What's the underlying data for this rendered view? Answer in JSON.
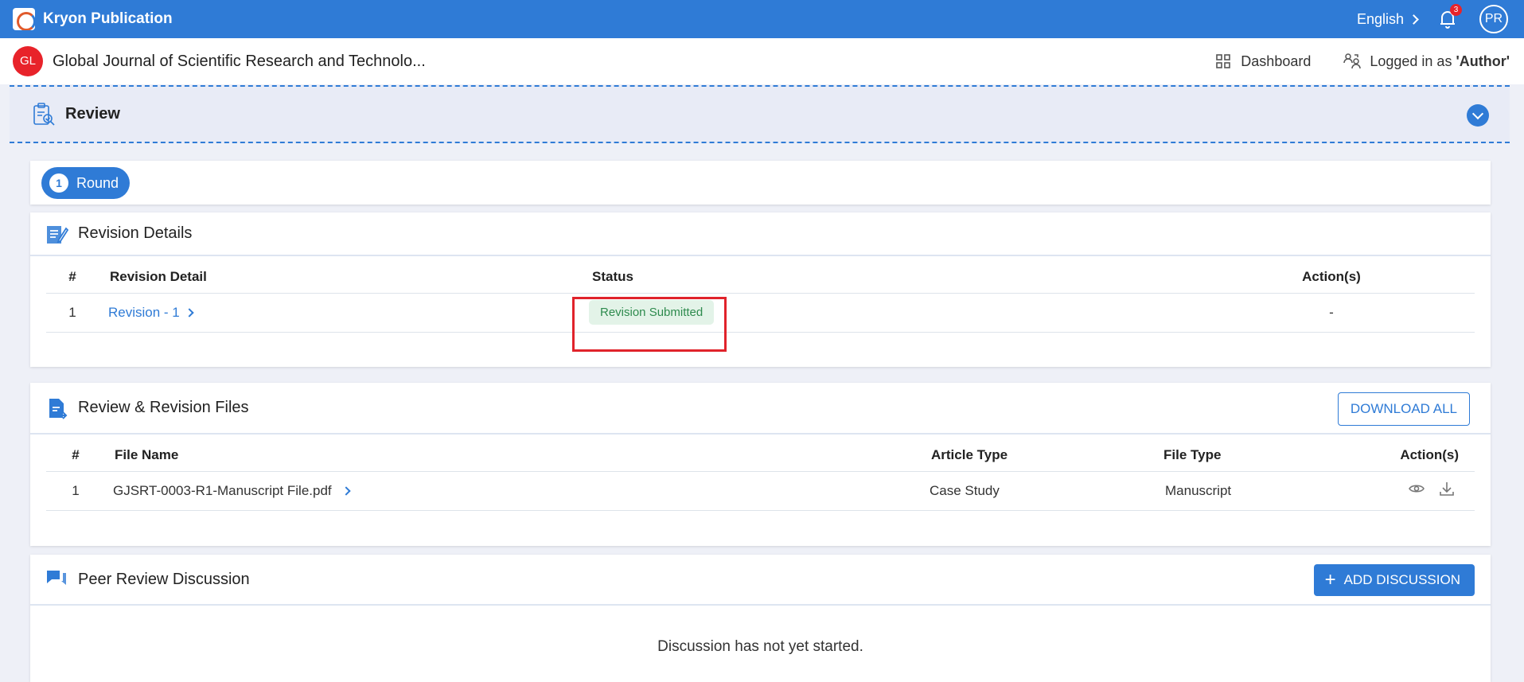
{
  "app": {
    "name": "Kryon Publication",
    "language": "English",
    "notifications": "3",
    "user_initials": "PR"
  },
  "journal": {
    "badge": "GL",
    "title": "Global Journal of Scientific Research and Technolo...",
    "dashboard_label": "Dashboard",
    "logged_in_prefix": "Logged in as",
    "role": "'Author'"
  },
  "review": {
    "title": "Review"
  },
  "round": {
    "number": "1",
    "label": "Round"
  },
  "revision_details": {
    "title": "Revision Details",
    "columns": [
      "#",
      "Revision Detail",
      "Status",
      "Action(s)"
    ],
    "rows": [
      {
        "index": "1",
        "detail": "Revision - 1",
        "status": "Revision Submitted",
        "action": "-"
      }
    ]
  },
  "files": {
    "title": "Review & Revision Files",
    "download_all": "DOWNLOAD ALL",
    "columns": [
      "#",
      "File Name",
      "Article Type",
      "File Type",
      "Action(s)"
    ],
    "rows": [
      {
        "index": "1",
        "file_name": "GJSRT-0003-R1-Manuscript File.pdf",
        "article_type": "Case Study",
        "file_type": "Manuscript"
      }
    ]
  },
  "discussion": {
    "title": "Peer Review Discussion",
    "add_button": "ADD DISCUSSION",
    "empty_message": "Discussion has not yet started."
  },
  "colors": {
    "primary": "#2f7bd6",
    "danger": "#e8232a",
    "success": "#2e8b4e"
  }
}
